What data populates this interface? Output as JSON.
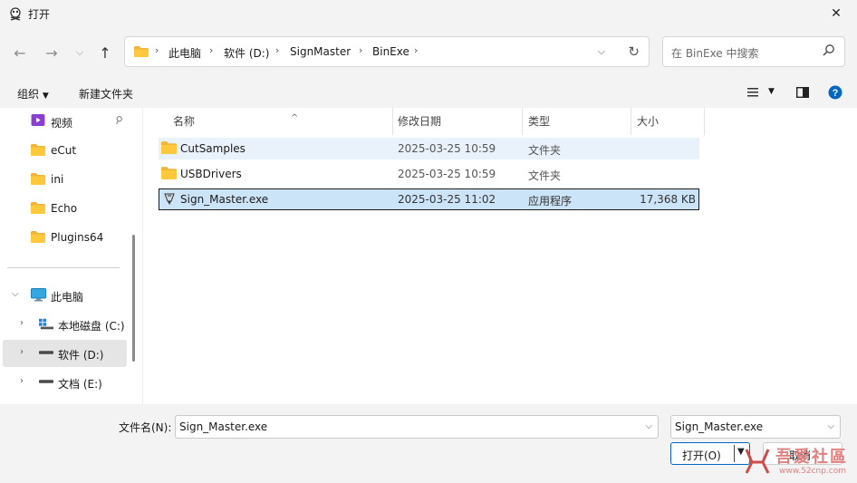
{
  "window": {
    "title": "打开",
    "close": "✕"
  },
  "nav": {
    "breadcrumbs": [
      "此电脑",
      "软件 (D:)",
      "SignMaster",
      "BinExe"
    ],
    "search_placeholder": "在 BinExe 中搜索"
  },
  "command_bar": {
    "organize": "组织",
    "new_folder": "新建文件夹"
  },
  "sidebar": {
    "items": [
      {
        "label": "视频",
        "icon": "video-icon"
      },
      {
        "label": "eCut",
        "icon": "folder-icon"
      },
      {
        "label": "ini",
        "icon": "folder-icon"
      },
      {
        "label": "Echo",
        "icon": "folder-icon"
      },
      {
        "label": "Plugins64",
        "icon": "folder-icon"
      },
      {
        "label": "此电脑",
        "icon": "pc-icon"
      },
      {
        "label": "本地磁盘 (C:)",
        "icon": "windows-drive-icon"
      },
      {
        "label": "软件 (D:)",
        "icon": "drive-icon"
      },
      {
        "label": "文档 (E:)",
        "icon": "drive-icon"
      }
    ]
  },
  "columns": {
    "name": "名称",
    "date": "修改日期",
    "type": "类型",
    "size": "大小"
  },
  "files": [
    {
      "name": "CutSamples",
      "date": "2025-03-25 10:59",
      "type": "文件夹",
      "size": ""
    },
    {
      "name": "USBDrivers",
      "date": "2025-03-25 10:59",
      "type": "文件夹",
      "size": ""
    },
    {
      "name": "Sign_Master.exe",
      "date": "2025-03-25 11:02",
      "type": "应用程序",
      "size": "17,368 KB"
    }
  ],
  "bottom": {
    "filename_label": "文件名(N):",
    "filename_value": "Sign_Master.exe",
    "filetype_value": "Sign_Master.exe",
    "open_label": "打开(O)",
    "cancel_label": "取消"
  },
  "watermark": {
    "text": "吾爱社區",
    "url": "www.52cnp.com"
  }
}
